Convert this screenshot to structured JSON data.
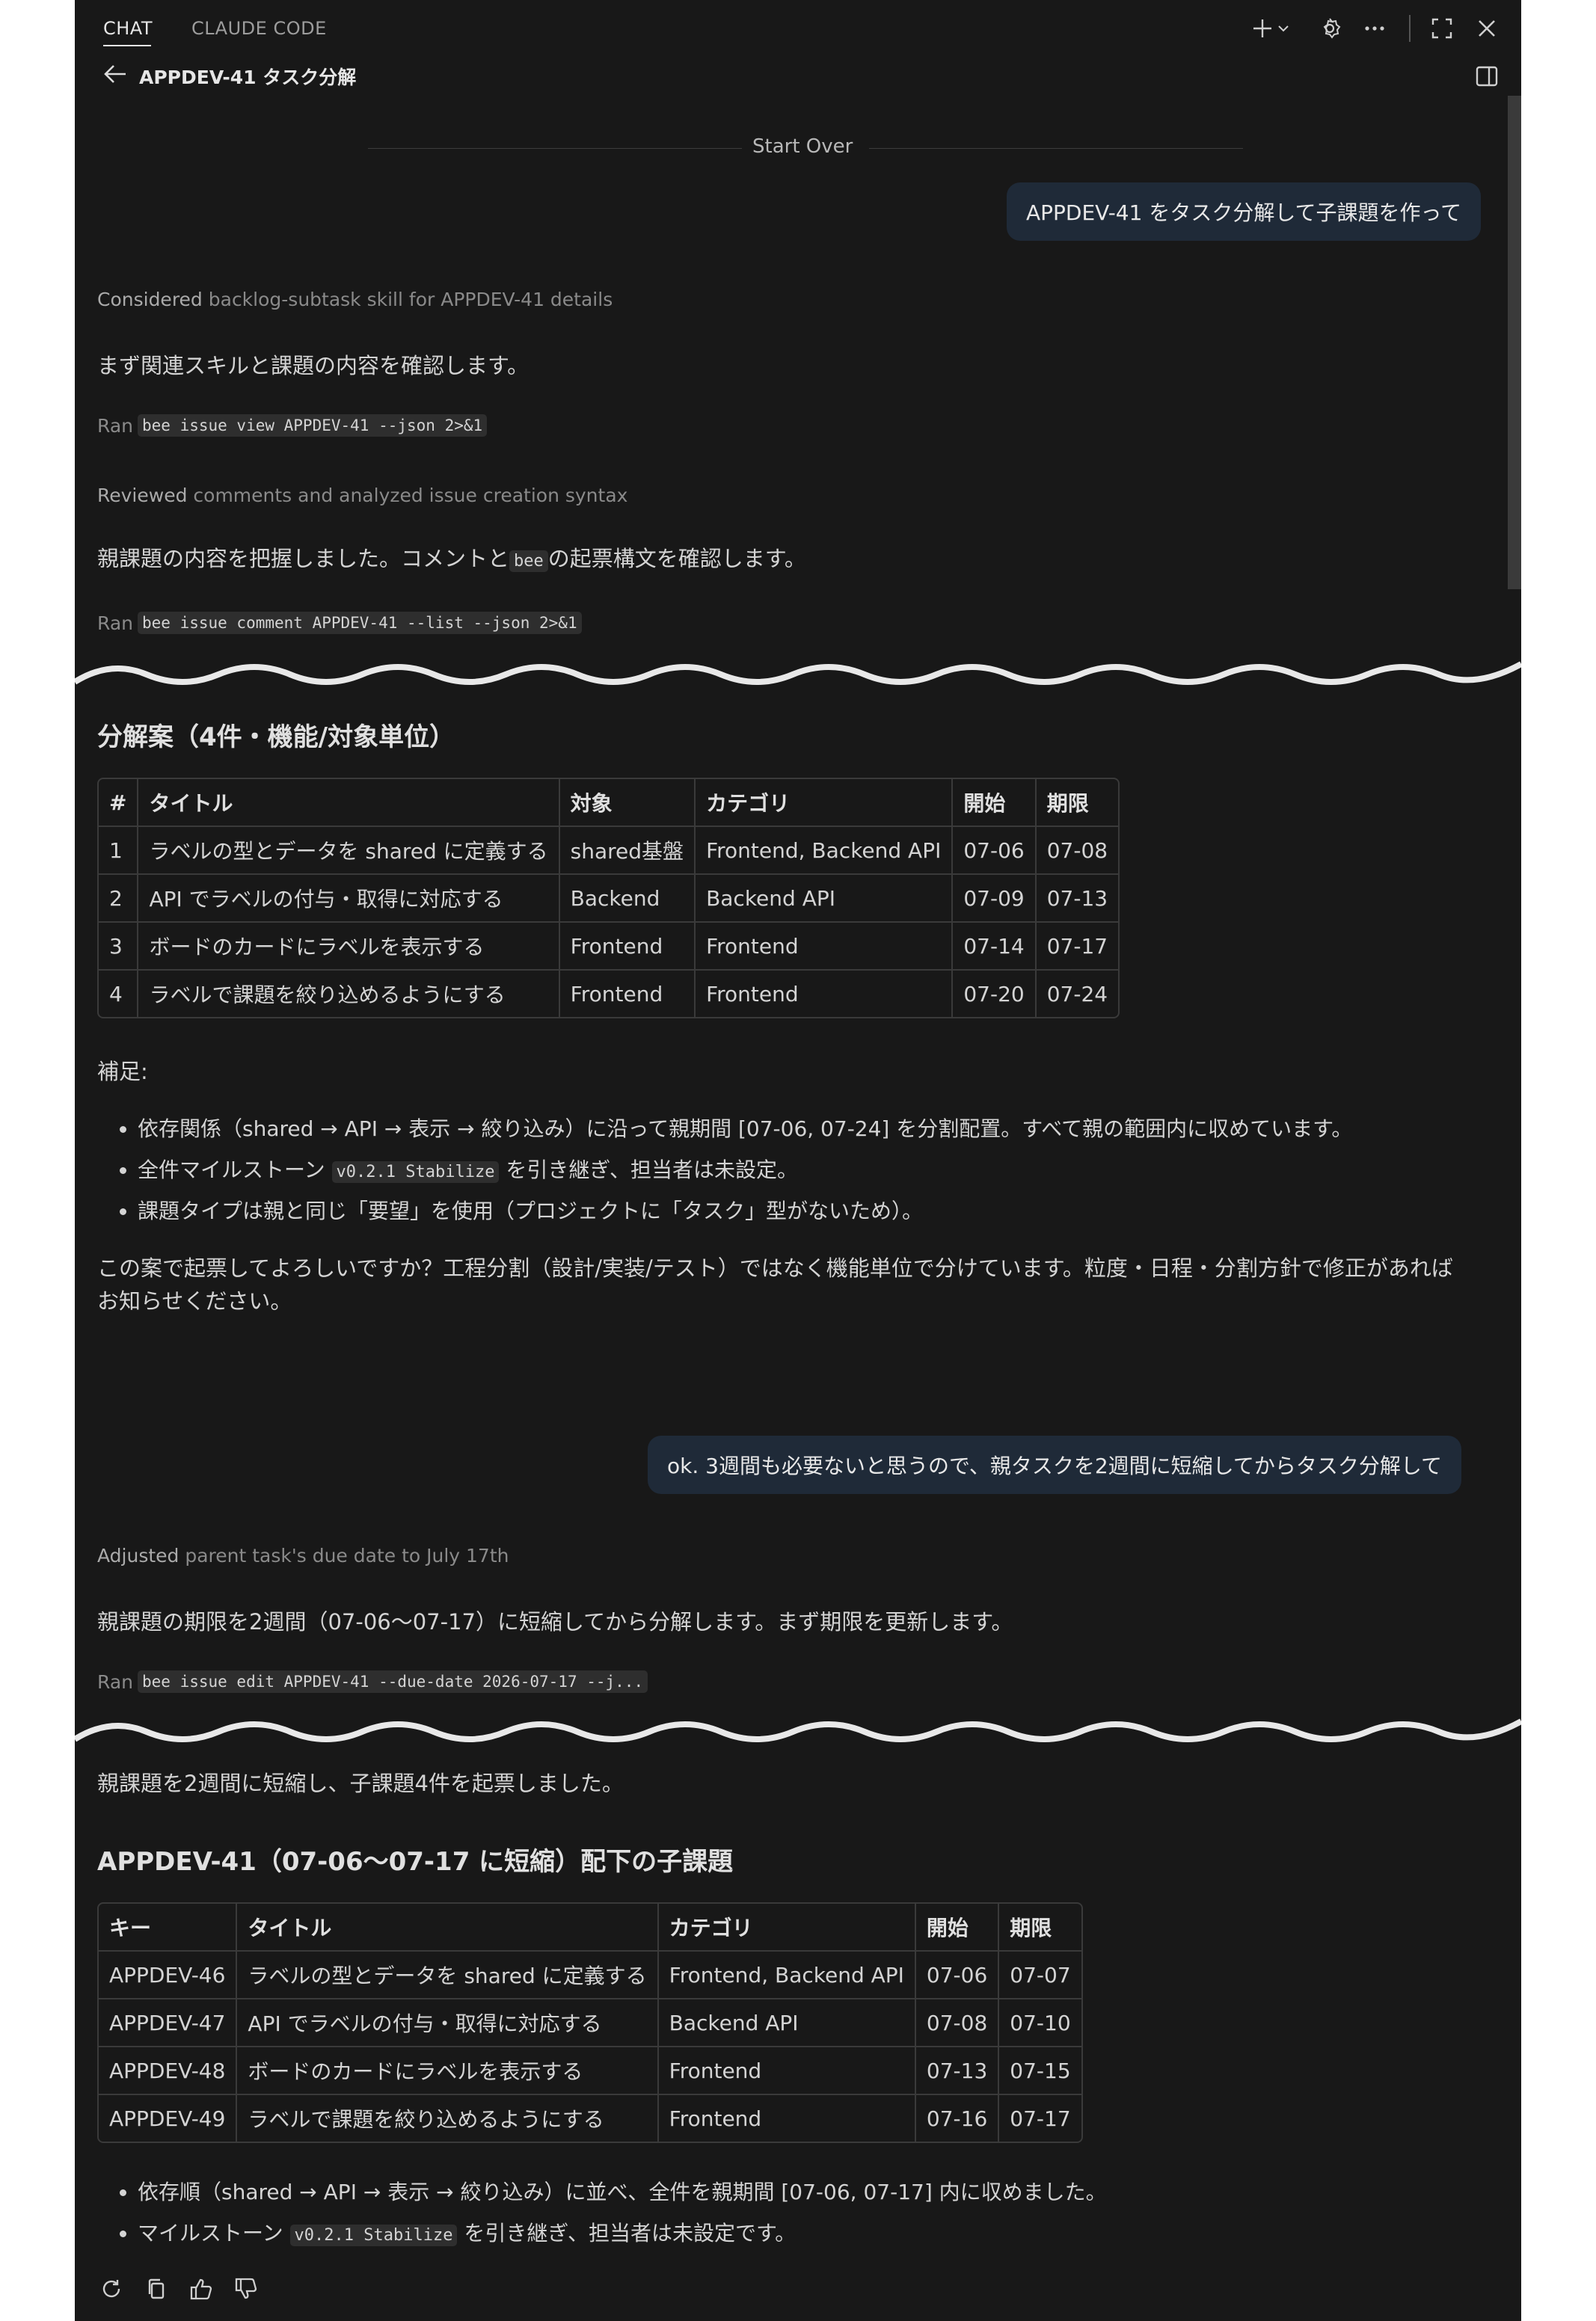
{
  "tabs": {
    "chat": "CHAT",
    "claude_code": "CLAUDE CODE"
  },
  "header": {
    "title": "APPDEV-41 タスク分解"
  },
  "start_over": "Start Over",
  "msg1": {
    "user": "APPDEV-41 をタスク分解して子課題を作って",
    "considered_verb": "Considered",
    "considered_text": "backlog-subtask skill for APPDEV-41 details",
    "text1": "まず関連スキルと課題の内容を確認します。",
    "ran_label": "Ran",
    "ran1_cmd": "bee issue view APPDEV-41 --json 2>&1",
    "reviewed_verb": "Reviewed",
    "reviewed_text": "comments and analyzed issue creation syntax",
    "text2_a": "親課題の内容を把握しました。コメントと",
    "text2_code": "bee",
    "text2_b": "の起票構文を確認します。",
    "ran2_cmd": "bee issue comment APPDEV-41 --list --json 2>&1"
  },
  "proposal": {
    "heading": "分解案（4件・機能/対象単位）",
    "headers": [
      "#",
      "タイトル",
      "対象",
      "カテゴリ",
      "開始",
      "期限"
    ],
    "rows": [
      [
        "1",
        "ラベルの型とデータを shared に定義する",
        "shared基盤",
        "Frontend, Backend API",
        "07-06",
        "07-08"
      ],
      [
        "2",
        "API でラベルの付与・取得に対応する",
        "Backend",
        "Backend API",
        "07-09",
        "07-13"
      ],
      [
        "3",
        "ボードのカードにラベルを表示する",
        "Frontend",
        "Frontend",
        "07-14",
        "07-17"
      ],
      [
        "4",
        "ラベルで課題を絞り込めるようにする",
        "Frontend",
        "Frontend",
        "07-20",
        "07-24"
      ]
    ],
    "supplement_label": "補足:",
    "bullet1": "依存関係（shared → API → 表示 → 絞り込み）に沿って親期間 [07-06, 07-24] を分割配置。すべて親の範囲内に収めています。",
    "bullet2_a": "全件マイルストーン",
    "bullet2_code": "v0.2.1 Stabilize",
    "bullet2_b": "を引き継ぎ、担当者は未設定。",
    "bullet3": "課題タイプは親と同じ「要望」を使用（プロジェクトに「タスク」型がないため）。",
    "question_line1": "この案で起票してよろしいですか？工程分割（設計/実装/テスト）ではなく機能単位で分けています。粒度・日程・分割方針で修正があれば",
    "question_line2": "お知らせください。"
  },
  "msg2": {
    "user": "ok. 3週間も必要ないと思うので、親タスクを2週間に短縮してからタスク分解して",
    "adjusted_verb": "Adjusted",
    "adjusted_text": "parent task's due date to July 17th",
    "text1": "親課題の期限を2週間（07-06〜07-17）に短縮してから分解します。まず期限を更新します。",
    "ran_cmd": "bee issue edit APPDEV-41 --due-date 2026-07-17 --j..."
  },
  "result": {
    "intro": "親課題を2週間に短縮し、子課題4件を起票しました。",
    "heading": "APPDEV-41（07-06〜07-17 に短縮）配下の子課題",
    "headers": [
      "キー",
      "タイトル",
      "カテゴリ",
      "開始",
      "期限"
    ],
    "rows": [
      [
        "APPDEV-46",
        "ラベルの型とデータを shared に定義する",
        "Frontend, Backend API",
        "07-06",
        "07-07"
      ],
      [
        "APPDEV-47",
        "API でラベルの付与・取得に対応する",
        "Backend API",
        "07-08",
        "07-10"
      ],
      [
        "APPDEV-48",
        "ボードのカードにラベルを表示する",
        "Frontend",
        "07-13",
        "07-15"
      ],
      [
        "APPDEV-49",
        "ラベルで課題を絞り込めるようにする",
        "Frontend",
        "07-16",
        "07-17"
      ]
    ],
    "bullet1": "依存順（shared → API → 表示 → 絞り込み）に並べ、全件を親期間 [07-06, 07-17] 内に収めました。",
    "bullet2_a": "マイルストーン",
    "bullet2_code": "v0.2.1 Stabilize",
    "bullet2_b": "を引き継ぎ、担当者は未設定です。"
  },
  "icons": {
    "top": [
      "plus-icon",
      "chevron-down-icon",
      "gear-icon",
      "more-icon",
      "maximize-icon",
      "close-icon"
    ],
    "actions": [
      "retry-icon",
      "copy-icon",
      "thumbs-up-icon",
      "thumbs-down-icon"
    ]
  }
}
